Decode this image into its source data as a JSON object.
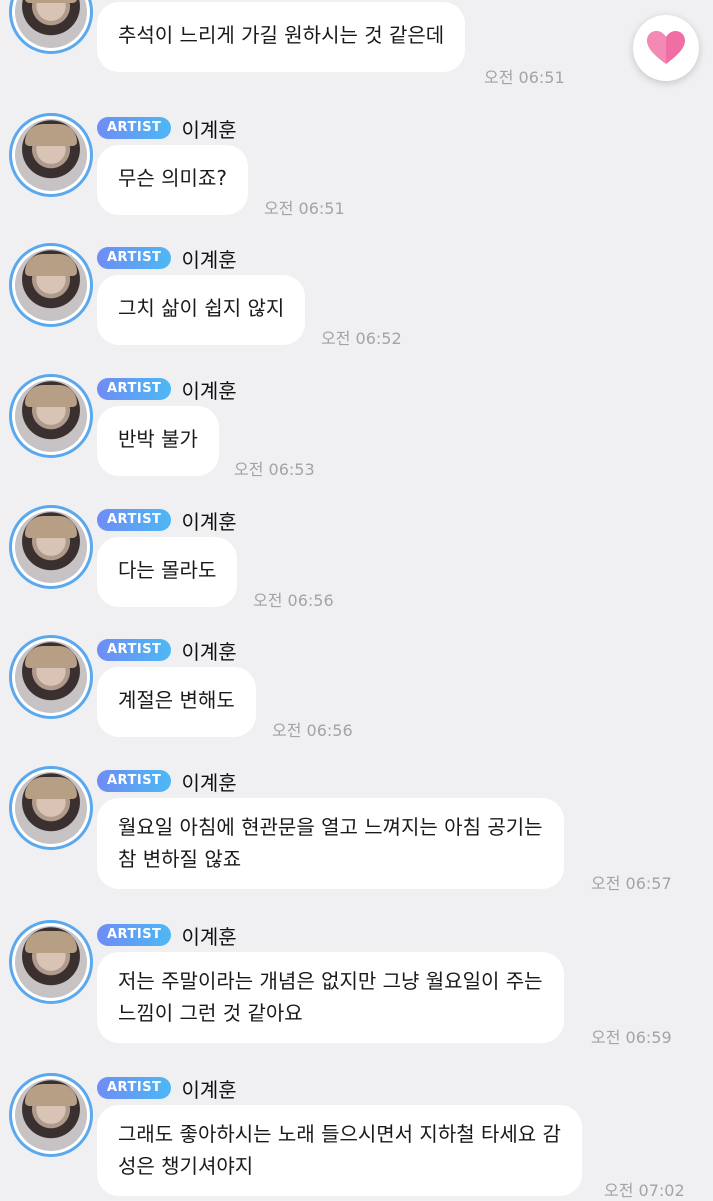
{
  "artist_badge": "ARTIST",
  "sender_name": "이계훈",
  "messages": [
    {
      "text": "추석이 느리게 가길 원하시는 것 같은데",
      "time": "오전 06:51"
    },
    {
      "text": "무슨 의미죠?",
      "time": "오전 06:51"
    },
    {
      "text": "그치 삶이 쉽지 않지",
      "time": "오전 06:52"
    },
    {
      "text": "반박 불가",
      "time": "오전 06:53"
    },
    {
      "text": "다는 몰라도",
      "time": "오전 06:56"
    },
    {
      "text": "계절은 변해도",
      "time": "오전 06:56"
    },
    {
      "line1": "월요일 아침에 현관문을 열고 느껴지는 아침 공기는",
      "line2": "참 변하질 않죠",
      "time": "오전 06:57"
    },
    {
      "line1": "저는 주말이라는 개념은 없지만 그냥 월요일이 주는",
      "line2": "느낌이 그런 것 같아요",
      "time": "오전 06:59"
    },
    {
      "line1": "그래도 좋아하시는 노래 들으시면서 지하철 타세요 감",
      "line2": "성은 챙기셔야지",
      "time": "오전 07:02"
    }
  ],
  "icons": {
    "heart": "heart-icon"
  },
  "colors": {
    "background": "#f0f0f2",
    "bubble": "#ffffff",
    "badge_start": "#6f8cf5",
    "badge_end": "#4db8f4",
    "heart": "#ef6fa4",
    "avatar_ring": "#5aa8ee"
  }
}
